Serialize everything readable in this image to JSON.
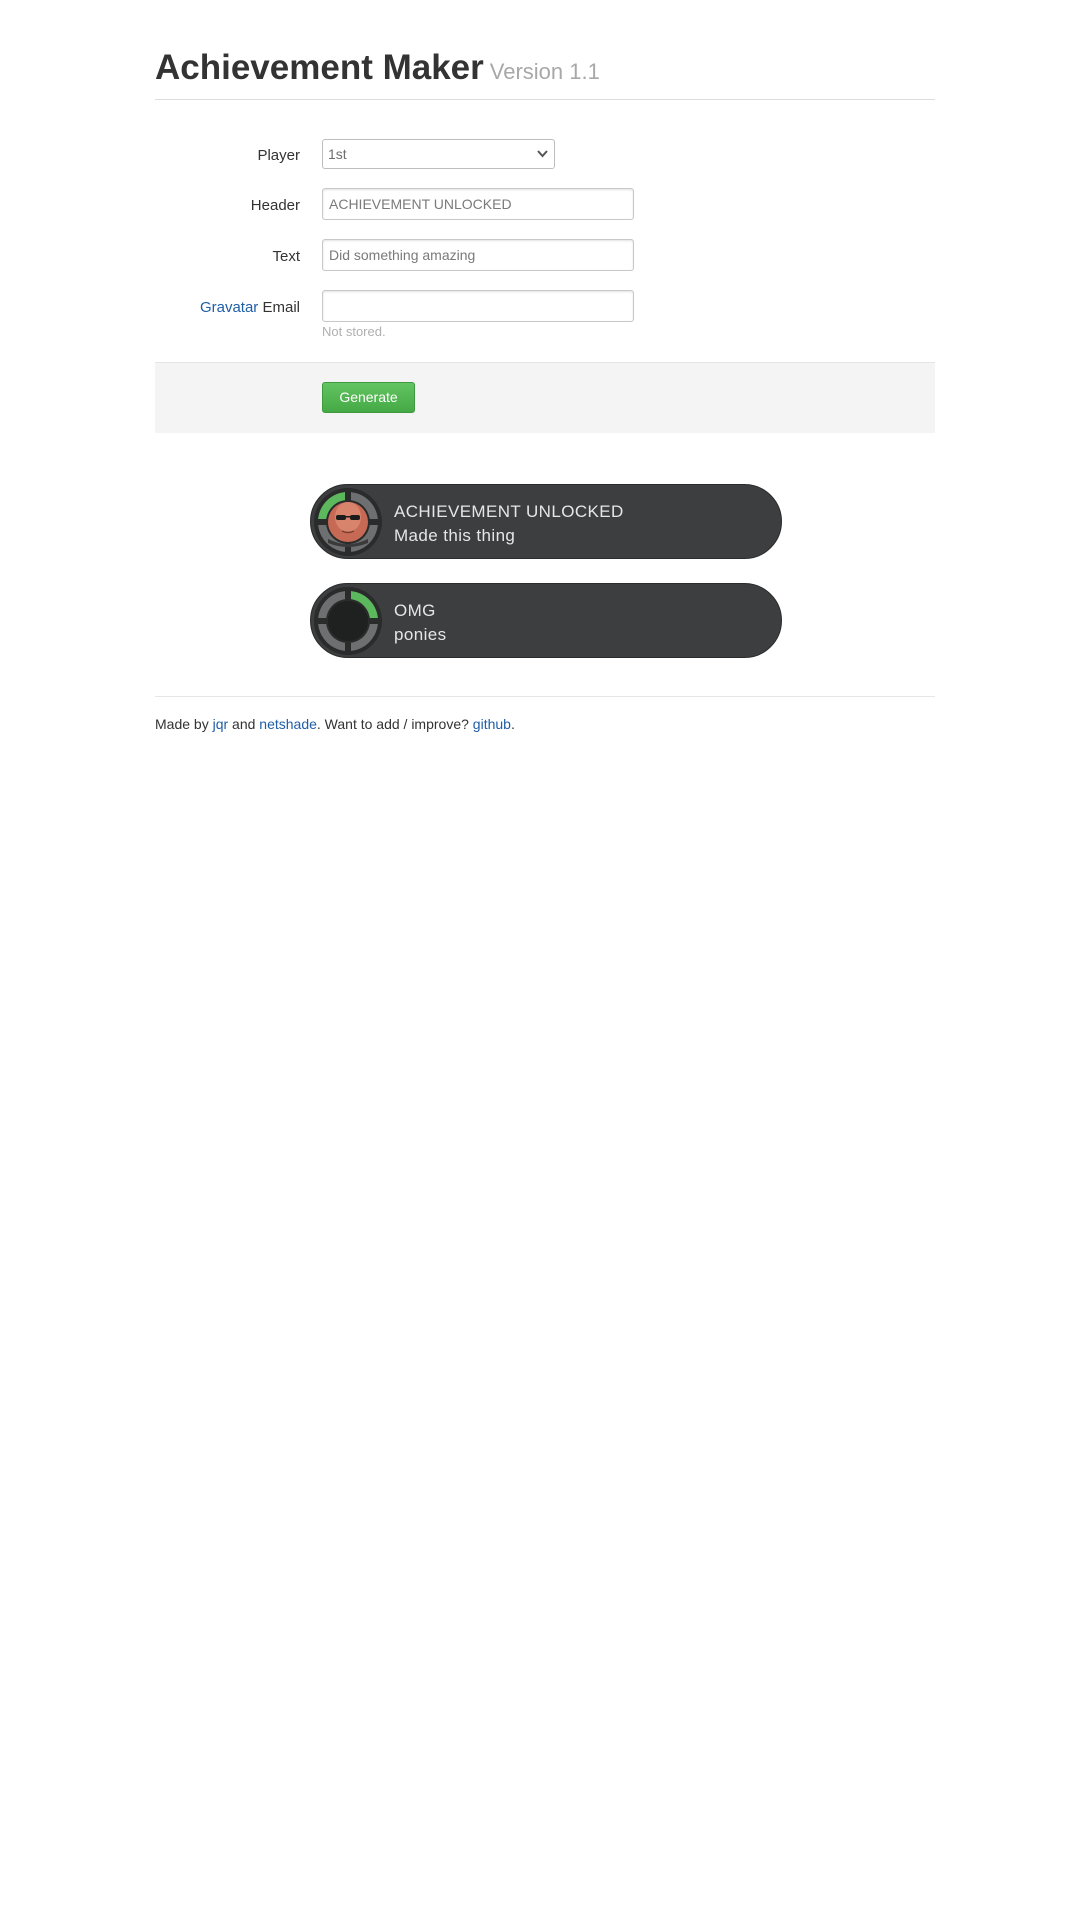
{
  "header": {
    "title": "Achievement Maker",
    "version": "Version 1.1"
  },
  "form": {
    "player": {
      "label": "Player",
      "value": "1st"
    },
    "header_field": {
      "label": "Header",
      "placeholder": "ACHIEVEMENT UNLOCKED"
    },
    "text_field": {
      "label": "Text",
      "placeholder": "Did something amazing"
    },
    "email_field": {
      "label_link": "Gravatar",
      "label_rest": " Email",
      "value": "",
      "help": "Not stored."
    },
    "generate_label": "Generate"
  },
  "achievements": [
    {
      "header": "ACHIEVEMENT UNLOCKED",
      "text": "Made this thing",
      "icon": "avatar-photo"
    },
    {
      "header": "OMG",
      "text": "ponies",
      "icon": "player-ring"
    }
  ],
  "colors": {
    "accent_green": "#5cb85c",
    "link": "#1f5ea8",
    "badge_bg": "#3c3e3f"
  },
  "footer": {
    "prefix": "Made by ",
    "author1": "jqr",
    "and": " and ",
    "author2": "netshade",
    "middle": ". Want to add / improve? ",
    "repo": "github",
    "suffix": "."
  }
}
